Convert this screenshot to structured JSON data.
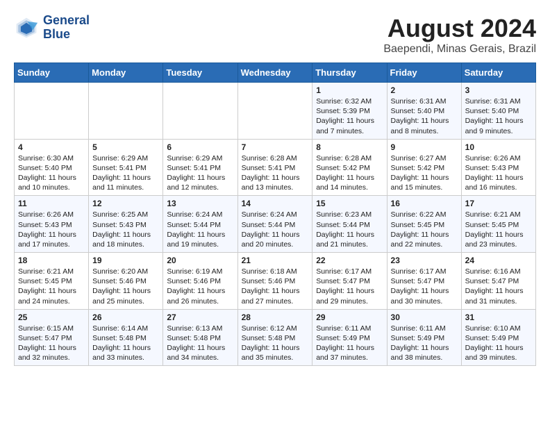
{
  "header": {
    "logo_line1": "General",
    "logo_line2": "Blue",
    "month": "August 2024",
    "location": "Baependi, Minas Gerais, Brazil"
  },
  "weekdays": [
    "Sunday",
    "Monday",
    "Tuesday",
    "Wednesday",
    "Thursday",
    "Friday",
    "Saturday"
  ],
  "weeks": [
    [
      {
        "day": "",
        "info": ""
      },
      {
        "day": "",
        "info": ""
      },
      {
        "day": "",
        "info": ""
      },
      {
        "day": "",
        "info": ""
      },
      {
        "day": "1",
        "info": "Sunrise: 6:32 AM\nSunset: 5:39 PM\nDaylight: 11 hours\nand 7 minutes."
      },
      {
        "day": "2",
        "info": "Sunrise: 6:31 AM\nSunset: 5:40 PM\nDaylight: 11 hours\nand 8 minutes."
      },
      {
        "day": "3",
        "info": "Sunrise: 6:31 AM\nSunset: 5:40 PM\nDaylight: 11 hours\nand 9 minutes."
      }
    ],
    [
      {
        "day": "4",
        "info": "Sunrise: 6:30 AM\nSunset: 5:40 PM\nDaylight: 11 hours\nand 10 minutes."
      },
      {
        "day": "5",
        "info": "Sunrise: 6:29 AM\nSunset: 5:41 PM\nDaylight: 11 hours\nand 11 minutes."
      },
      {
        "day": "6",
        "info": "Sunrise: 6:29 AM\nSunset: 5:41 PM\nDaylight: 11 hours\nand 12 minutes."
      },
      {
        "day": "7",
        "info": "Sunrise: 6:28 AM\nSunset: 5:41 PM\nDaylight: 11 hours\nand 13 minutes."
      },
      {
        "day": "8",
        "info": "Sunrise: 6:28 AM\nSunset: 5:42 PM\nDaylight: 11 hours\nand 14 minutes."
      },
      {
        "day": "9",
        "info": "Sunrise: 6:27 AM\nSunset: 5:42 PM\nDaylight: 11 hours\nand 15 minutes."
      },
      {
        "day": "10",
        "info": "Sunrise: 6:26 AM\nSunset: 5:43 PM\nDaylight: 11 hours\nand 16 minutes."
      }
    ],
    [
      {
        "day": "11",
        "info": "Sunrise: 6:26 AM\nSunset: 5:43 PM\nDaylight: 11 hours\nand 17 minutes."
      },
      {
        "day": "12",
        "info": "Sunrise: 6:25 AM\nSunset: 5:43 PM\nDaylight: 11 hours\nand 18 minutes."
      },
      {
        "day": "13",
        "info": "Sunrise: 6:24 AM\nSunset: 5:44 PM\nDaylight: 11 hours\nand 19 minutes."
      },
      {
        "day": "14",
        "info": "Sunrise: 6:24 AM\nSunset: 5:44 PM\nDaylight: 11 hours\nand 20 minutes."
      },
      {
        "day": "15",
        "info": "Sunrise: 6:23 AM\nSunset: 5:44 PM\nDaylight: 11 hours\nand 21 minutes."
      },
      {
        "day": "16",
        "info": "Sunrise: 6:22 AM\nSunset: 5:45 PM\nDaylight: 11 hours\nand 22 minutes."
      },
      {
        "day": "17",
        "info": "Sunrise: 6:21 AM\nSunset: 5:45 PM\nDaylight: 11 hours\nand 23 minutes."
      }
    ],
    [
      {
        "day": "18",
        "info": "Sunrise: 6:21 AM\nSunset: 5:45 PM\nDaylight: 11 hours\nand 24 minutes."
      },
      {
        "day": "19",
        "info": "Sunrise: 6:20 AM\nSunset: 5:46 PM\nDaylight: 11 hours\nand 25 minutes."
      },
      {
        "day": "20",
        "info": "Sunrise: 6:19 AM\nSunset: 5:46 PM\nDaylight: 11 hours\nand 26 minutes."
      },
      {
        "day": "21",
        "info": "Sunrise: 6:18 AM\nSunset: 5:46 PM\nDaylight: 11 hours\nand 27 minutes."
      },
      {
        "day": "22",
        "info": "Sunrise: 6:17 AM\nSunset: 5:47 PM\nDaylight: 11 hours\nand 29 minutes."
      },
      {
        "day": "23",
        "info": "Sunrise: 6:17 AM\nSunset: 5:47 PM\nDaylight: 11 hours\nand 30 minutes."
      },
      {
        "day": "24",
        "info": "Sunrise: 6:16 AM\nSunset: 5:47 PM\nDaylight: 11 hours\nand 31 minutes."
      }
    ],
    [
      {
        "day": "25",
        "info": "Sunrise: 6:15 AM\nSunset: 5:47 PM\nDaylight: 11 hours\nand 32 minutes."
      },
      {
        "day": "26",
        "info": "Sunrise: 6:14 AM\nSunset: 5:48 PM\nDaylight: 11 hours\nand 33 minutes."
      },
      {
        "day": "27",
        "info": "Sunrise: 6:13 AM\nSunset: 5:48 PM\nDaylight: 11 hours\nand 34 minutes."
      },
      {
        "day": "28",
        "info": "Sunrise: 6:12 AM\nSunset: 5:48 PM\nDaylight: 11 hours\nand 35 minutes."
      },
      {
        "day": "29",
        "info": "Sunrise: 6:11 AM\nSunset: 5:49 PM\nDaylight: 11 hours\nand 37 minutes."
      },
      {
        "day": "30",
        "info": "Sunrise: 6:11 AM\nSunset: 5:49 PM\nDaylight: 11 hours\nand 38 minutes."
      },
      {
        "day": "31",
        "info": "Sunrise: 6:10 AM\nSunset: 5:49 PM\nDaylight: 11 hours\nand 39 minutes."
      }
    ]
  ]
}
